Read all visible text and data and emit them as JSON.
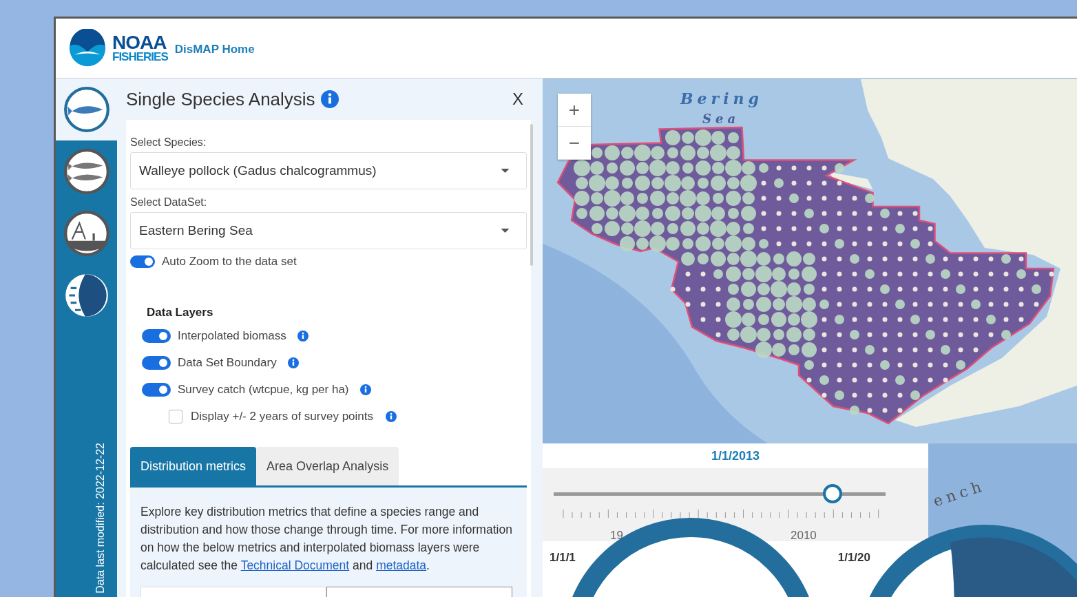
{
  "header": {
    "logo_text": "NOAA",
    "logo_subtext": "FISHERIES",
    "home_link": "DisMAP Home"
  },
  "sidebar": {
    "items": [
      {
        "kind": "fish",
        "selected": true
      },
      {
        "kind": "two-fish",
        "selected": false
      },
      {
        "kind": "boat",
        "selected": false
      },
      {
        "kind": "moon",
        "selected": false
      }
    ],
    "footer": "Data last modified: 2022-12-22"
  },
  "panel": {
    "title": "Single Species Analysis",
    "close": "X",
    "fields": [
      {
        "label": "Select Species:",
        "value": "Walleye pollock (Gadus chalcogrammus)"
      },
      {
        "label": "Select DataSet:",
        "value": "Eastern Bering Sea"
      }
    ],
    "auto_zoom": {
      "label": "Auto Zoom to the data set",
      "on": true
    },
    "layers_title": "Data Layers",
    "layers": [
      {
        "kind": "toggle",
        "label": "Interpolated biomass",
        "on": true
      },
      {
        "kind": "toggle",
        "label": "Data Set Boundary",
        "on": true
      },
      {
        "kind": "toggle",
        "label": "Survey catch (wtcpue, kg per ha)",
        "on": true
      },
      {
        "kind": "checkbox",
        "label": "Display +/- 2 years of survey points",
        "on": false
      }
    ],
    "tabs": [
      {
        "label": "Distribution metrics",
        "selected": true
      },
      {
        "label": "Area Overlap Analysis",
        "selected": false
      }
    ],
    "description": [
      {
        "kind": "text",
        "text": "Explore key distribution metrics that define a species range and distribution and how those change through time. For more information on how the below metrics and interpolated biomass layers were calculated see the "
      },
      {
        "kind": "link",
        "text": "Technical Document"
      },
      {
        "kind": "text",
        "text": " and "
      },
      {
        "kind": "link",
        "text": "metadata"
      },
      {
        "kind": "text",
        "text": "."
      }
    ]
  },
  "map": {
    "zoom_in": "+",
    "zoom_out": "−",
    "labels": [
      "Bering",
      "Sea",
      "ench"
    ]
  },
  "time_slider": {
    "date": "1/1/2013",
    "level": 0.84,
    "tick_labels": [
      "19",
      "2010"
    ],
    "start": "1/1/1",
    "end": "1/1/20"
  }
}
